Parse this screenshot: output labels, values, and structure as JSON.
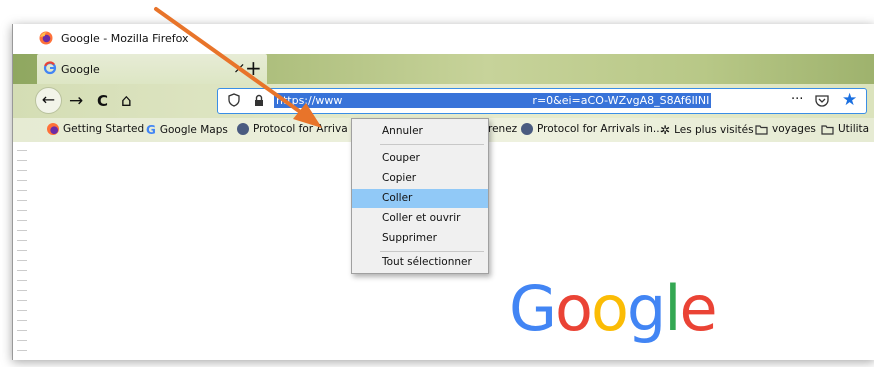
{
  "window": {
    "title": "Google - Mozilla Firefox"
  },
  "tab": {
    "label": "Google",
    "close": "×",
    "new_tab": "+"
  },
  "nav": {
    "back": "←",
    "forward": "→",
    "reload": "C",
    "home": "⌂"
  },
  "url": {
    "prefix": "https://www",
    "suffix": "r=0&ei=aCO-WZvgA8_S8Af6lINI",
    "more": "···"
  },
  "bookmarks": {
    "items": [
      {
        "label": "Getting Started",
        "icon": "firefox-icon"
      },
      {
        "label": "Google Maps",
        "icon": "google-icon"
      },
      {
        "label": "Protocol for Arriva",
        "icon": "globe-icon"
      },
      {
        "label": "renez ...",
        "icon": ""
      },
      {
        "label": "Protocol for Arrivals in...",
        "icon": "globe-icon"
      },
      {
        "label": "Les plus visités",
        "icon": "gear-icon"
      },
      {
        "label": "voyages",
        "icon": "folder-icon"
      },
      {
        "label": "Utilita",
        "icon": "folder-icon"
      }
    ]
  },
  "context_menu": {
    "items": [
      {
        "label": "Annuler",
        "highlighted": false
      },
      {
        "label": "Couper",
        "highlighted": false
      },
      {
        "label": "Copier",
        "highlighted": false
      },
      {
        "label": "Coller",
        "highlighted": true
      },
      {
        "label": "Coller et ouvrir",
        "highlighted": false
      },
      {
        "label": "Supprimer",
        "highlighted": false
      },
      {
        "label": "Tout sélectionner",
        "highlighted": false
      }
    ]
  },
  "logo": {
    "letters": [
      "G",
      "o",
      "o",
      "g",
      "l",
      "e"
    ],
    "colors": [
      "#4285f4",
      "#ea4335",
      "#fbbc05",
      "#4285f4",
      "#34a853",
      "#ea4335"
    ]
  },
  "colors": {
    "selection": "#3873d9",
    "menu_highlight": "#91c9f7",
    "annotation_arrow": "#e8742a"
  }
}
